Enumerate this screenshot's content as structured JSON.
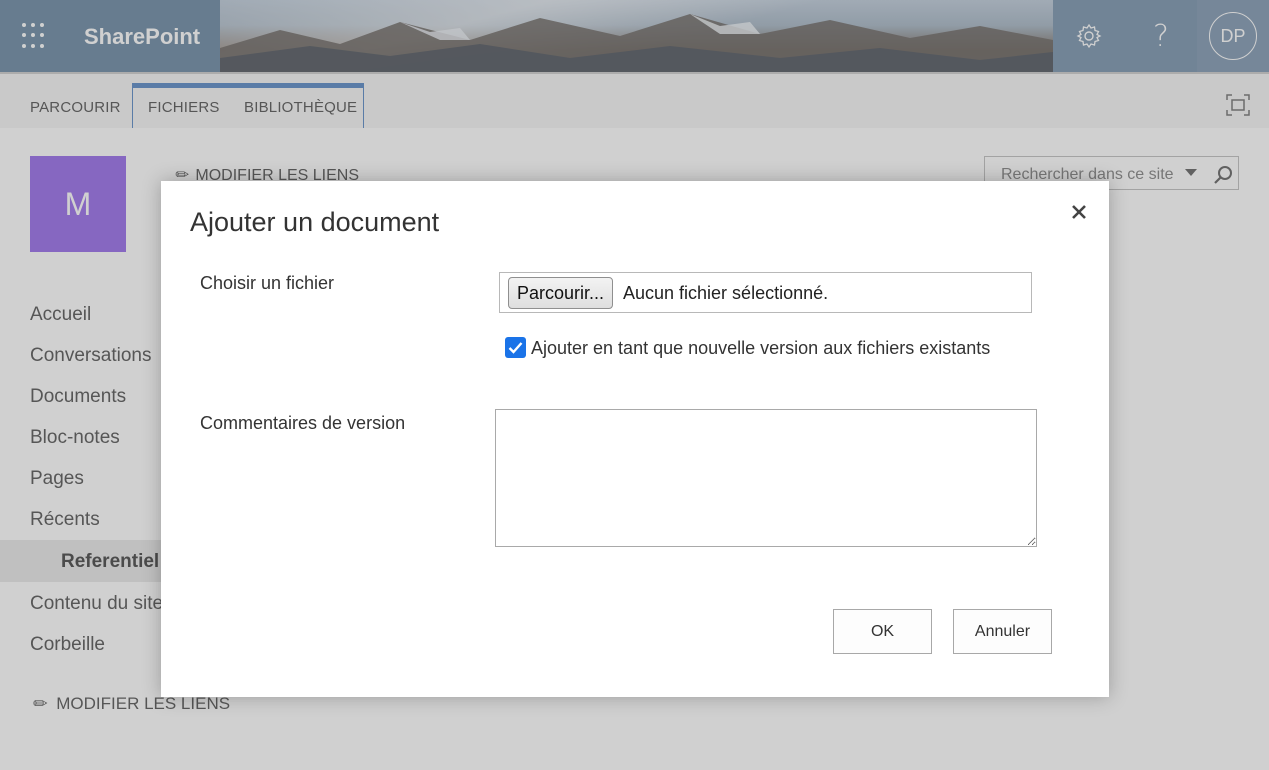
{
  "suite": {
    "brand": "SharePoint",
    "avatar_initials": "DP",
    "icons": [
      "waffle-icon",
      "gear-icon",
      "help-icon"
    ]
  },
  "ribbon": {
    "tabs": [
      "PARCOURIR",
      "FICHIERS",
      "BIBLIOTHÈQUE"
    ]
  },
  "site": {
    "logo_letter": "M",
    "edit_links_top": "MODIFIER LES LIENS",
    "search_placeholder": "Rechercher dans ce site",
    "nav": [
      "Accueil",
      "Conversations",
      "Documents",
      "Bloc-notes",
      "Pages",
      "Récents",
      "Referentiel",
      "Contenu du site",
      "Corbeille"
    ],
    "edit_links_bottom": "MODIFIER LES LIENS"
  },
  "dialog": {
    "title": "Ajouter un document",
    "choose_file_label": "Choisir un fichier",
    "browse_button": "Parcourir...",
    "no_file_text": "Aucun fichier sélectionné.",
    "add_version_label": "Ajouter en tant que nouvelle version aux fichiers existants",
    "add_version_checked": true,
    "version_comments_label": "Commentaires de version",
    "version_comments_value": "",
    "ok_button": "OK",
    "cancel_button": "Annuler"
  },
  "colors": {
    "accent_blue": "#4a7fc1",
    "logo_purple": "#8e5fe8",
    "checkbox_blue": "#1a73e8"
  }
}
